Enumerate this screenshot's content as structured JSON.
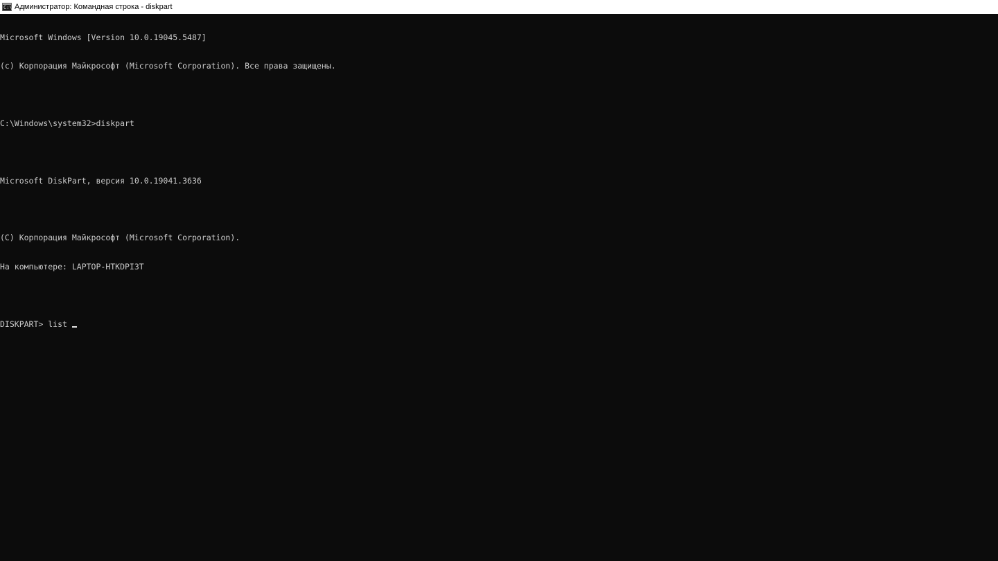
{
  "window": {
    "title": "Администратор: Командная строка - diskpart",
    "icon": "cmd-icon"
  },
  "console": {
    "lines": [
      "Microsoft Windows [Version 10.0.19045.5487]",
      "(c) Корпорация Майкрософт (Microsoft Corporation). Все права защищены.",
      "",
      "C:\\Windows\\system32>diskpart",
      "",
      "Microsoft DiskPart, версия 10.0.19041.3636",
      "",
      "(C) Корпорация Майкрософт (Microsoft Corporation).",
      "На компьютере: LAPTOP-HTKDPI3T",
      ""
    ],
    "prompt": "DISKPART> ",
    "input": "list "
  },
  "colors": {
    "background": "#0c0c0c",
    "text": "#cccccc",
    "titlebar": "#ffffff"
  }
}
